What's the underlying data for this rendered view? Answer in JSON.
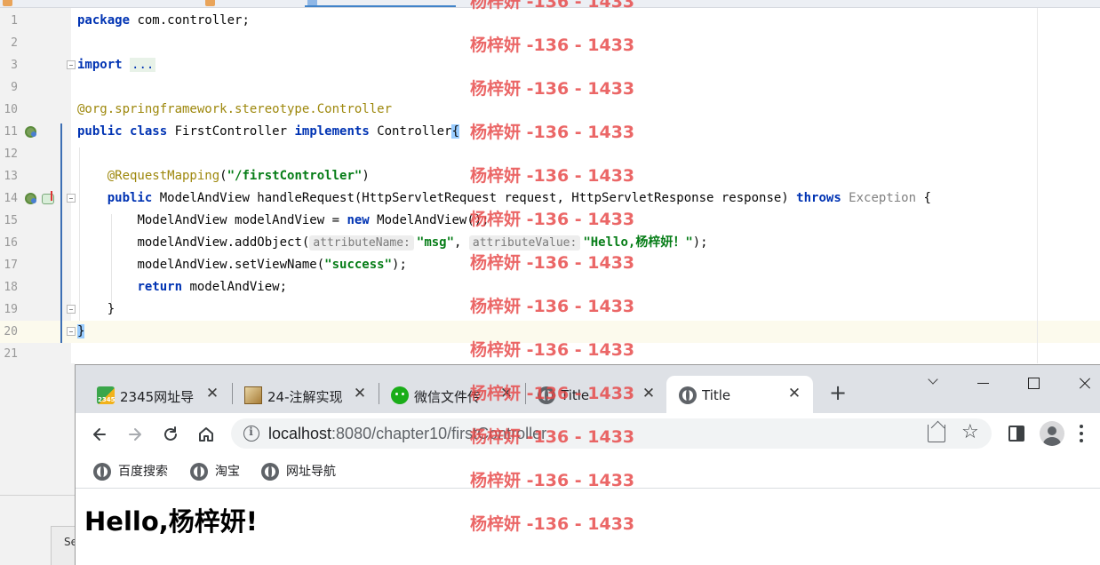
{
  "ide": {
    "lines": [
      {
        "n": "1"
      },
      {
        "n": "2"
      },
      {
        "n": "3"
      },
      {
        "n": "9"
      },
      {
        "n": "10"
      },
      {
        "n": "11"
      },
      {
        "n": "12"
      },
      {
        "n": "13"
      },
      {
        "n": "14"
      },
      {
        "n": "15"
      },
      {
        "n": "16"
      },
      {
        "n": "17"
      },
      {
        "n": "18"
      },
      {
        "n": "19"
      },
      {
        "n": "20"
      },
      {
        "n": "21"
      }
    ],
    "code": {
      "l1_kw": "package",
      "l1_rest": " com.controller;",
      "l3_kw": "import",
      "l3_fold": "...",
      "l10_prefix": "@org.springframework.stereotype.",
      "l10_ann": "Controller",
      "l11_kw1": "public",
      "l11_kw2": "class",
      "l11_name": " FirstController ",
      "l11_kw3": "implements",
      "l11_iface": " Controller",
      "l11_brace": "{",
      "l13_ann": "@RequestMapping",
      "l13_open": "(",
      "l13_str": "\"/firstController\"",
      "l13_close": ")",
      "l14_kw1": "public",
      "l14_sig": " ModelAndView handleRequest(HttpServletRequest request, HttpServletResponse response) ",
      "l14_kw2": "throws",
      "l14_exc": " Exception",
      "l14_brace": " {",
      "l15_a": "ModelAndView modelAndView = ",
      "l15_kw": "new",
      "l15_b": " ModelAndView();",
      "l16_a": "modelAndView.addObject(",
      "l16_hint1": "attributeName:",
      "l16_str1": "\"msg\"",
      "l16_comma": ", ",
      "l16_hint2": "attributeValue:",
      "l16_str2": "\"Hello,杨梓妍！\"",
      "l16_end": ");",
      "l17_a": "modelAndView.setViewName(",
      "l17_str": "\"success\"",
      "l17_end": ");",
      "l18_kw": "return",
      "l18_rest": " modelAndView;",
      "l19": "}",
      "l20": "}"
    },
    "bottom_tab": "Se"
  },
  "watermark": {
    "text": "杨梓妍 -136 - 1433",
    "count": 13
  },
  "browser": {
    "tabs": [
      {
        "label": "2345网址导",
        "icon": "2345-favicon"
      },
      {
        "label": "24-注解实现",
        "icon": "image-favicon"
      },
      {
        "label": "微信文件传",
        "icon": "wechat-favicon"
      },
      {
        "label": "Title",
        "icon": "globe-icon"
      },
      {
        "label": "Title",
        "icon": "globe-icon",
        "active": true
      }
    ],
    "close_glyph": "✕",
    "new_tab_glyph": "+",
    "url_host": "localhost",
    "url_path": ":8080/chapter10/firstController",
    "bookmarks": [
      {
        "label": "百度搜索"
      },
      {
        "label": "淘宝"
      },
      {
        "label": "网址导航"
      }
    ],
    "page_heading": "Hello,杨梓妍!"
  }
}
